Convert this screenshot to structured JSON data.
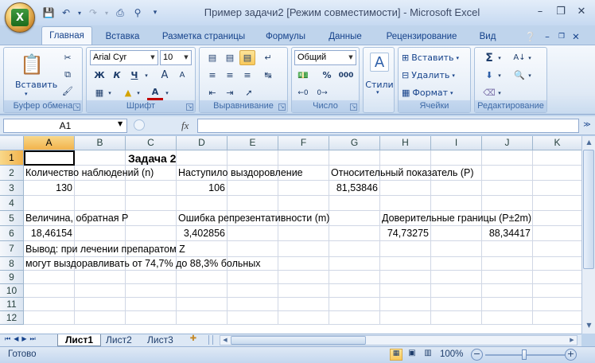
{
  "window": {
    "title": "Пример задачи2  [Режим совместимости] - Microsoft Excel",
    "logo": "X"
  },
  "qat": {
    "icons": [
      "save-icon",
      "undo-icon",
      "redo-icon",
      "print-icon",
      "preview-icon",
      "customize-icon"
    ]
  },
  "tabs": [
    "Главная",
    "Вставка",
    "Разметка страницы",
    "Формулы",
    "Данные",
    "Рецензирование",
    "Вид"
  ],
  "ribbon": {
    "clipboard": {
      "label": "Буфер обмена",
      "paste": "Вставить"
    },
    "font": {
      "label": "Шрифт",
      "name": "Arial Cyr",
      "size": "10",
      "bold": "Ж",
      "italic": "К",
      "underline": "Ч",
      "grow": "A",
      "shrink": "A",
      "color_letter": "A",
      "font_color": "#c00000"
    },
    "align": {
      "label": "Выравнивание"
    },
    "number": {
      "label": "Число",
      "format": "Общий",
      "percent": "%",
      "thousands": "000"
    },
    "styles": {
      "label": "Стили"
    },
    "cells": {
      "label": "Ячейки",
      "insert": "Вставить",
      "delete": "Удалить",
      "format": "Формат"
    },
    "editing": {
      "label": "Редактирование"
    }
  },
  "formula_bar": {
    "name_box": "A1",
    "fx": "fx",
    "content": ""
  },
  "columns": [
    "A",
    "B",
    "C",
    "D",
    "E",
    "F",
    "G",
    "H",
    "I",
    "J",
    "K"
  ],
  "rows": [
    "1",
    "2",
    "3",
    "4",
    "5",
    "6",
    "7",
    "8",
    "9",
    "10",
    "11",
    "12"
  ],
  "cells": {
    "C1": "Задача 2",
    "A2": "Количество наблюдений (n)",
    "D2": "Наступило выздоровление",
    "G2": "Относительный показатель (P)",
    "A3": "130",
    "D3": "106",
    "G3": "81,53846",
    "A5": "Величина, обратная P",
    "D5": "Ошибка репрезентативности (m)",
    "H5": "Доверительные границы (P±2m)",
    "A6": "18,46154",
    "D6": "3,402856",
    "H6": "74,73275",
    "J6": "88,34417",
    "A7": "Вывод: при лечении препаратом Z",
    "A8": "могут выздоравливать от 74,7% до 88,3% больных"
  },
  "sheets": [
    "Лист1",
    "Лист2",
    "Лист3"
  ],
  "status": {
    "ready": "Готово",
    "zoom": "100%"
  }
}
